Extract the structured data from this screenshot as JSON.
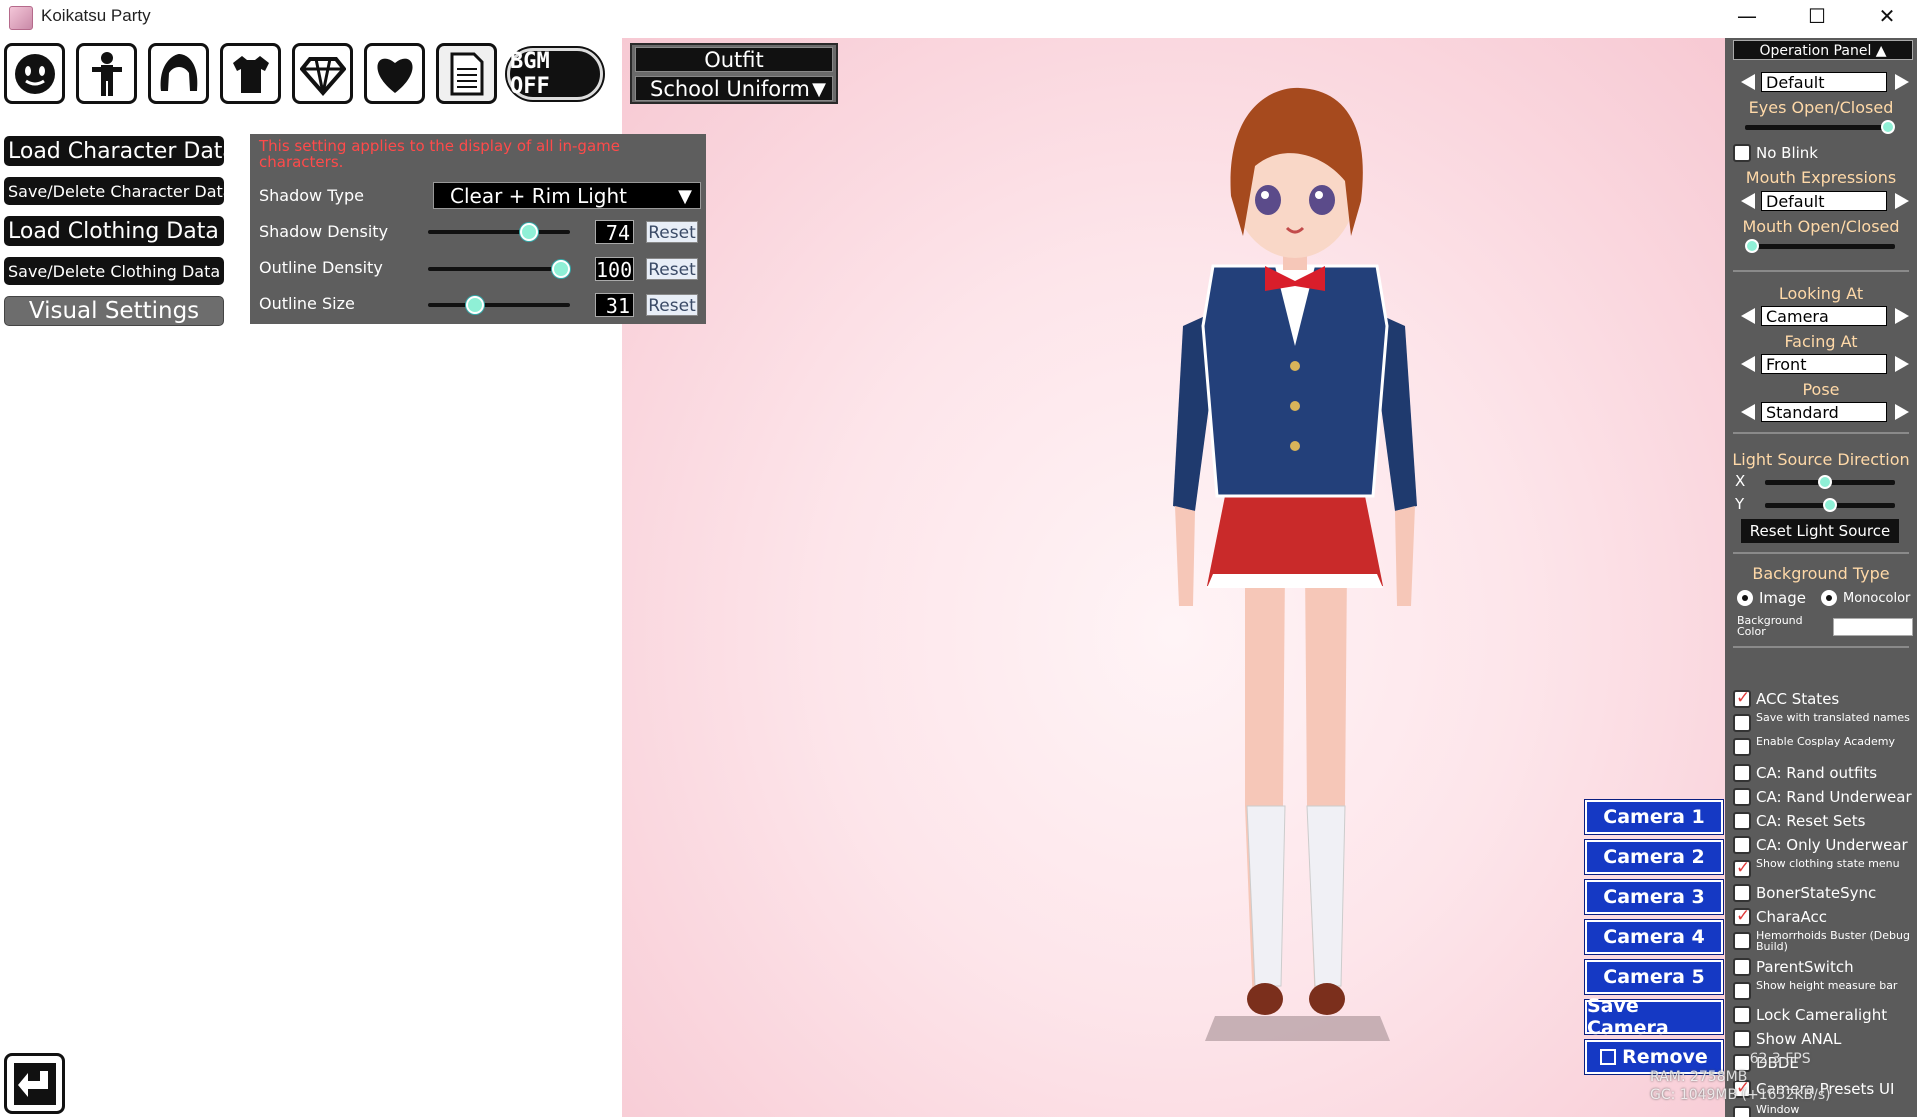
{
  "window": {
    "title": "Koikatsu Party",
    "minimize_glyph": "—",
    "maximize_glyph": "☐",
    "close_glyph": "✕"
  },
  "top_icons": [
    "face-icon",
    "body-icon",
    "hair-icon",
    "clothes-icon",
    "accessory-icon",
    "heart-icon",
    "document-icon"
  ],
  "bgm": {
    "label": "BGM OFF"
  },
  "outfit": {
    "label": "Outfit",
    "selected": "School Uniform",
    "arrow": "▼"
  },
  "left_menu": {
    "load_character": "Load Character Data",
    "save_delete_character": "Save/Delete Character Data",
    "load_clothing": "Load Clothing Data",
    "save_delete_clothing": "Save/Delete Clothing Data",
    "visual_settings": "Visual Settings"
  },
  "visual_settings": {
    "note": "This setting applies to the display of all in-game characters.",
    "shadow_type_label": "Shadow Type",
    "shadow_type_value": "Clear + Rim Light",
    "reset_label": "Reset",
    "sliders": [
      {
        "label": "Shadow Density",
        "value": "74",
        "fraction": 0.74
      },
      {
        "label": "Outline Density",
        "value": "100",
        "fraction": 1.0
      },
      {
        "label": "Outline Size",
        "value": "31",
        "fraction": 0.31
      }
    ]
  },
  "cameras": {
    "camera1": "Camera 1",
    "camera2": "Camera 2",
    "camera3": "Camera 3",
    "camera4": "Camera 4",
    "camera5": "Camera 5",
    "save": "Save Camera",
    "remove": "Remove"
  },
  "operation_panel": {
    "header": "Operation Panel ▲",
    "eye_expr_value": "Default",
    "eyes_open_closed": "Eyes Open/Closed",
    "eyes_open_fraction": 1.0,
    "no_blink": "No Blink",
    "mouth_expressions": "Mouth Expressions",
    "mouth_expr_value": "Default",
    "mouth_open_closed": "Mouth Open/Closed",
    "mouth_open_fraction": 0.0,
    "looking_at": "Looking At",
    "looking_at_value": "Camera",
    "facing_at": "Facing At",
    "facing_at_value": "Front",
    "pose": "Pose",
    "pose_value": "Standard",
    "light_source_direction": "Light Source Direction",
    "x_label": "X",
    "y_label": "Y",
    "light_x_fraction": 0.46,
    "light_y_fraction": 0.5,
    "reset_light_source": "Reset Light Source",
    "background_type": "Background Type",
    "bg_image": "Image",
    "bg_monocolor": "Monocolor",
    "background_color": "Background Color",
    "checks": [
      {
        "label": "ACC States",
        "on": true,
        "small": false
      },
      {
        "label": "Save with translated names",
        "on": false,
        "small": true
      },
      {
        "label": "Enable Cosplay Academy",
        "on": false,
        "small": true
      },
      {
        "label": "CA: Rand outfits",
        "on": false,
        "small": false
      },
      {
        "label": "CA: Rand Underwear",
        "on": false,
        "small": false
      },
      {
        "label": "CA: Reset Sets",
        "on": false,
        "small": false
      },
      {
        "label": "CA: Only Underwear",
        "on": false,
        "small": false
      },
      {
        "label": "Show clothing state menu",
        "on": true,
        "small": true
      },
      {
        "label": "BonerStateSync",
        "on": false,
        "small": false
      },
      {
        "label": "CharaAcc",
        "on": true,
        "small": false
      },
      {
        "label": "Hemorrhoids Buster (Debug Build)",
        "on": false,
        "small": true
      },
      {
        "label": "ParentSwitch",
        "on": false,
        "small": false
      },
      {
        "label": "Show height measure bar",
        "on": false,
        "small": true
      },
      {
        "label": "Lock Cameralight",
        "on": false,
        "small": false
      },
      {
        "label": "Show ANAL",
        "on": false,
        "small": false
      },
      {
        "label": "DBDE",
        "on": false,
        "small": false
      },
      {
        "label": "Camera Presets UI",
        "on": true,
        "small": false
      },
      {
        "label": "Window",
        "on": false,
        "small": true
      }
    ]
  },
  "hud": {
    "fps": "62.3 FPS",
    "ram": "RAM: 2758MB",
    "gc": "GC: 1049MB (+1632KB/s)"
  }
}
